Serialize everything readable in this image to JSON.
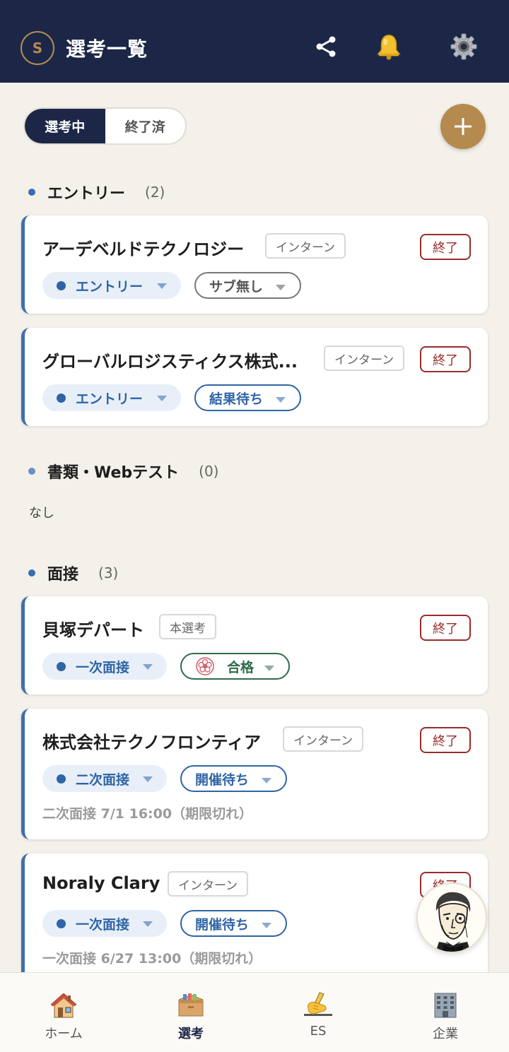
{
  "header": {
    "avatar_initial": "S",
    "title": "選考一覧"
  },
  "segment": {
    "active_label": "選考中",
    "inactive_label": "終了済"
  },
  "sections": {
    "entry": {
      "title": "エントリー",
      "count": "(2)"
    },
    "docs": {
      "title": "書類・Webテスト",
      "count": "(0)",
      "empty": "なし"
    },
    "interview": {
      "title": "面接",
      "count": "(3)"
    }
  },
  "cards": [
    {
      "name": "アーデベルドテクノロジー",
      "type": "インターン",
      "end": "終了",
      "stage": "エントリー",
      "status": "サブ無し"
    },
    {
      "name": "グローバルロジスティクス株式...",
      "type": "インターン",
      "end": "終了",
      "stage": "エントリー",
      "status": "結果待ち"
    },
    {
      "name": "貝塚デパート",
      "type": "本選考",
      "end": "終了",
      "stage": "一次面接",
      "status": "合格"
    },
    {
      "name": "株式会社テクノフロンティア",
      "type": "インターン",
      "end": "終了",
      "stage": "二次面接",
      "status": "開催待ち",
      "note": "二次面接 7/1 16:00（期限切れ）"
    },
    {
      "name": "Noraly Clary",
      "type": "インターン",
      "end": "終了",
      "stage": "一次面接",
      "status": "開催待ち",
      "note": "一次面接 6/27 13:00（期限切れ）"
    }
  ],
  "nav": [
    {
      "label": "ホーム",
      "icon": "house-icon"
    },
    {
      "label": "選考",
      "icon": "box-icon"
    },
    {
      "label": "ES",
      "icon": "writing-hand-icon"
    },
    {
      "label": "企業",
      "icon": "building-icon"
    }
  ],
  "colors": {
    "header_bg": "#1c2747",
    "accent_gold": "#b58a4f",
    "stage_blue": "#2f64a5",
    "end_red": "#9a2b2b"
  }
}
